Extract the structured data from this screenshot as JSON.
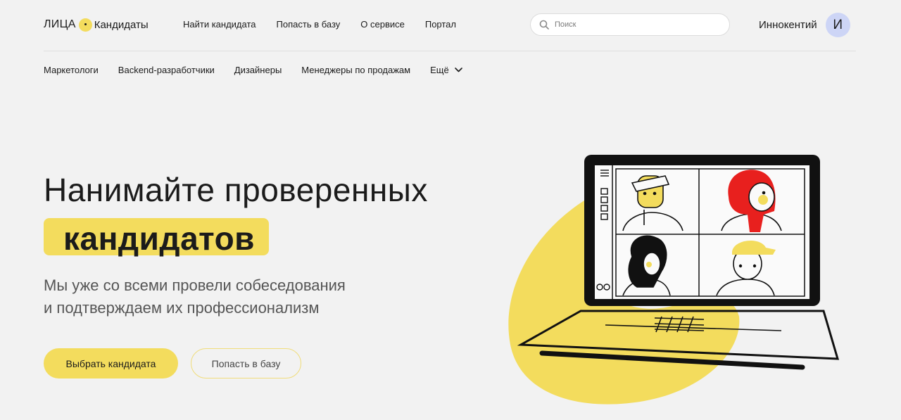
{
  "header": {
    "logo_word": "ЛИЦА",
    "logo_sub": "Кандидаты",
    "nav": [
      {
        "label": "Найти кандидата"
      },
      {
        "label": "Попасть в базу"
      },
      {
        "label": "О сервисе"
      },
      {
        "label": "Портал"
      }
    ],
    "search": {
      "placeholder": "Поиск",
      "value": "",
      "icon": "search-icon"
    },
    "user": {
      "name": "Иннокентий",
      "avatar_letter": "И"
    }
  },
  "categories": {
    "items": [
      {
        "label": "Маркетологи"
      },
      {
        "label": "Backend-разработчики"
      },
      {
        "label": "Дизайнеры"
      },
      {
        "label": "Менеджеры по продажам"
      }
    ],
    "more_label": "Ещё",
    "more_icon": "chevron-down-icon"
  },
  "hero": {
    "title_line1": "Нанимайте проверенных",
    "title_line2": "кандидатов",
    "subtitle_line1": "Мы уже со всеми провели собеседования",
    "subtitle_line2": "и подтверждаем их профессионализм",
    "primary_button": "Выбрать кандидата",
    "secondary_button": "Попасть в базу"
  },
  "colors": {
    "accent": "#f3dc5d",
    "background": "#f2f2f2",
    "avatar_bg": "#cdd5f6",
    "illustration_red": "#e8201e"
  }
}
